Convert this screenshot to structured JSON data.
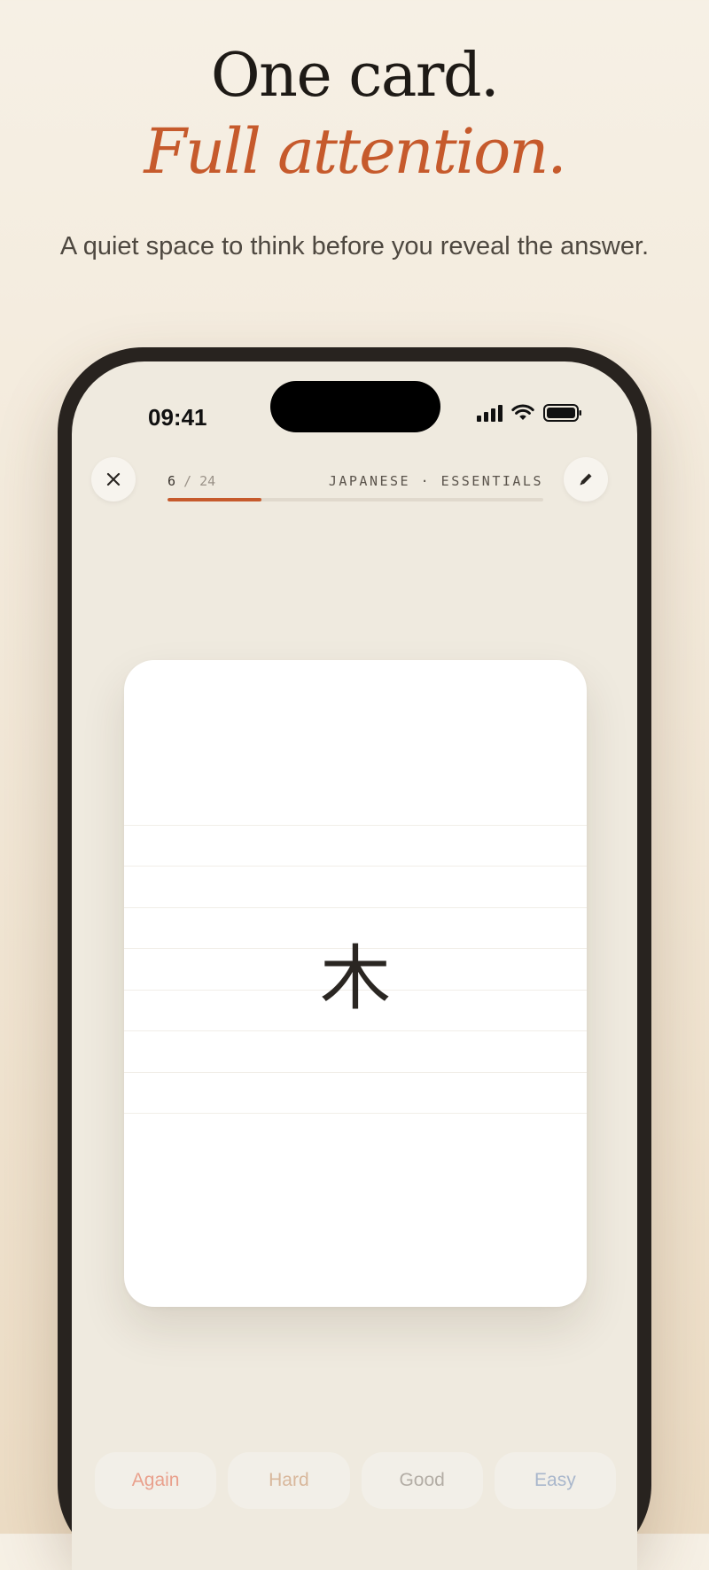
{
  "headline": {
    "line1": "One card.",
    "line2": "Full attention."
  },
  "subtitle": "A quiet space to think before you reveal the answer.",
  "status_bar": {
    "time": "09:41",
    "icons": [
      "cellular-signal-icon",
      "wifi-icon",
      "battery-icon"
    ]
  },
  "session": {
    "current": "6",
    "separator": "/",
    "total": "24",
    "progress_fraction": 0.25,
    "deck": "JAPANESE · ESSENTIALS",
    "close_icon": "close-icon",
    "edit_icon": "pencil-icon"
  },
  "card": {
    "front": "木"
  },
  "grades": [
    {
      "label": "Again",
      "color": "#e9a08c"
    },
    {
      "label": "Hard",
      "color": "#d8b79b"
    },
    {
      "label": "Good",
      "color": "#b3ada5"
    },
    {
      "label": "Easy",
      "color": "#a9b7cc"
    }
  ],
  "colors": {
    "accent": "#c65a2c",
    "ink": "#1e1a16",
    "phone_frame": "#28231f",
    "screen_bg": "#efeadf"
  }
}
